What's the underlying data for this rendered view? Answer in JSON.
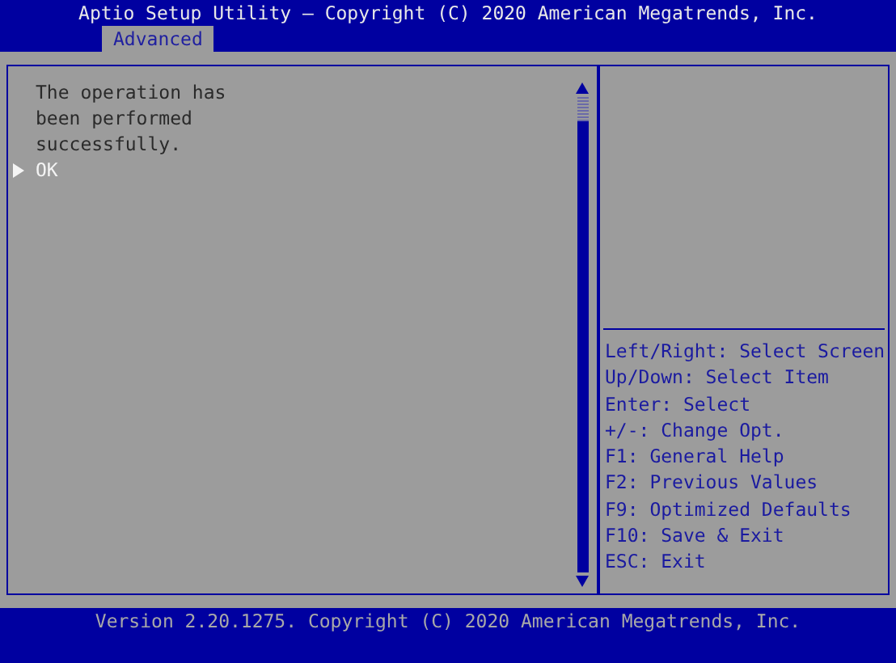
{
  "header": {
    "title": "Aptio Setup Utility – Copyright (C) 2020 American Megatrends, Inc.",
    "tabs": [
      {
        "label": "Advanced",
        "selected": true
      }
    ]
  },
  "main": {
    "message": "The operation has been performed successfully.",
    "items": [
      {
        "label": "OK",
        "selected": true
      }
    ]
  },
  "help": [
    "Left/Right: Select Screen",
    "Up/Down: Select Item",
    "Enter: Select",
    "+/-: Change Opt.",
    "F1: General Help",
    "F2: Previous Values",
    "F9: Optimized Defaults",
    "F10: Save & Exit",
    "ESC: Exit"
  ],
  "footer": "Version 2.20.1275. Copyright (C) 2020 American Megatrends, Inc."
}
